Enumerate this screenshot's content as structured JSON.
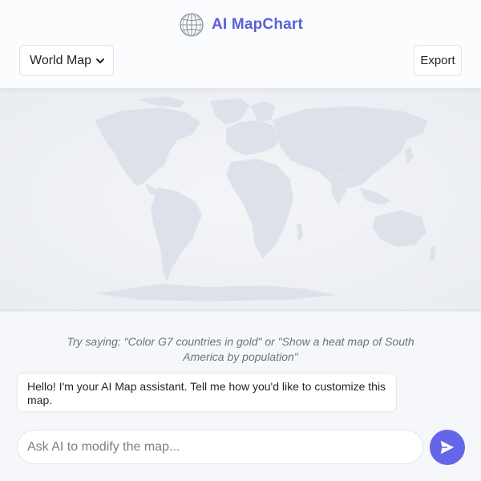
{
  "header": {
    "title": "AI MapChart",
    "logo_icon": "globe-icon",
    "accent_color": "#5b5fd6"
  },
  "toolbar": {
    "map_select": {
      "selected": "World Map"
    },
    "export_label": "Export"
  },
  "map": {
    "land_color": "#dde2ea",
    "background_color": "#eceef2"
  },
  "chat": {
    "hint": "Try saying: \"Color G7 countries in gold\" or \"Show a heat map of South America by population\"",
    "messages": [
      {
        "role": "assistant",
        "text": "Hello! I'm your AI Map assistant. Tell me how you'd like to customize this map."
      }
    ],
    "input": {
      "value": "",
      "placeholder": "Ask AI to modify the map..."
    },
    "send_icon": "send-icon",
    "send_color": "#6366e9"
  }
}
